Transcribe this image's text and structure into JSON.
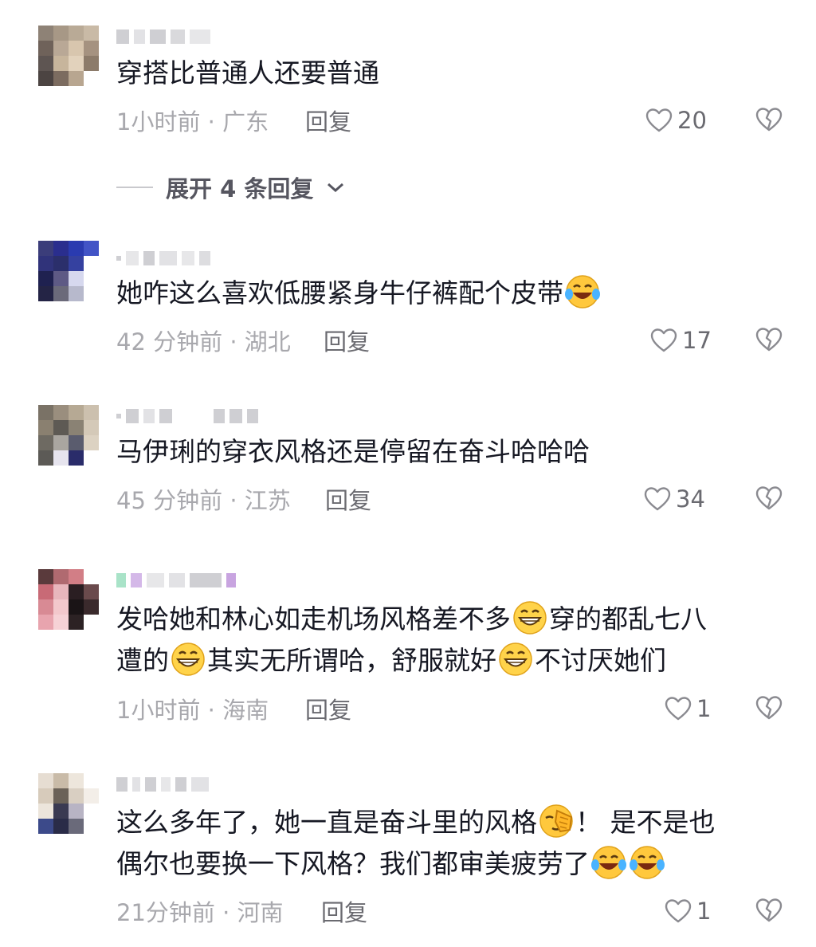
{
  "expand_replies": "展开 4 条回复",
  "reply_label": "回复",
  "comments": [
    {
      "lines": [
        "穿搭比普通人还要普通"
      ],
      "time_location": "1小时前 · 广东",
      "likes": "20"
    },
    {
      "lines": [
        "她咋这么喜欢低腰紧身牛仔裤配个皮带"
      ],
      "emoji_after": "laugh-cry-emoji",
      "time_location": "42 分钟前 · 湖北",
      "likes": "17"
    },
    {
      "lines": [
        "马伊琍的穿衣风格还是停留在奋斗哈哈哈"
      ],
      "time_location": "45 分钟前 · 江苏",
      "likes": "34"
    },
    {
      "segments": [
        "发哈她和林心如走机场风格差不多",
        "穿的都乱七八",
        "遭的",
        "其实无所谓哈，舒服就好",
        "不讨厌她们"
      ],
      "emojis": [
        "grin-emoji"
      ],
      "time_location": "1小时前 · 海南",
      "likes": "1"
    },
    {
      "segments": [
        "这么多年了，她一直是奋斗里的风格",
        "！ 是不是也",
        "偶尔也要换一下风格？我们都审美疲劳了"
      ],
      "emojis": [
        "facepalm-emoji",
        "laugh-cry-emoji"
      ],
      "time_location": "21分钟前 · 河南",
      "likes": "1"
    }
  ]
}
